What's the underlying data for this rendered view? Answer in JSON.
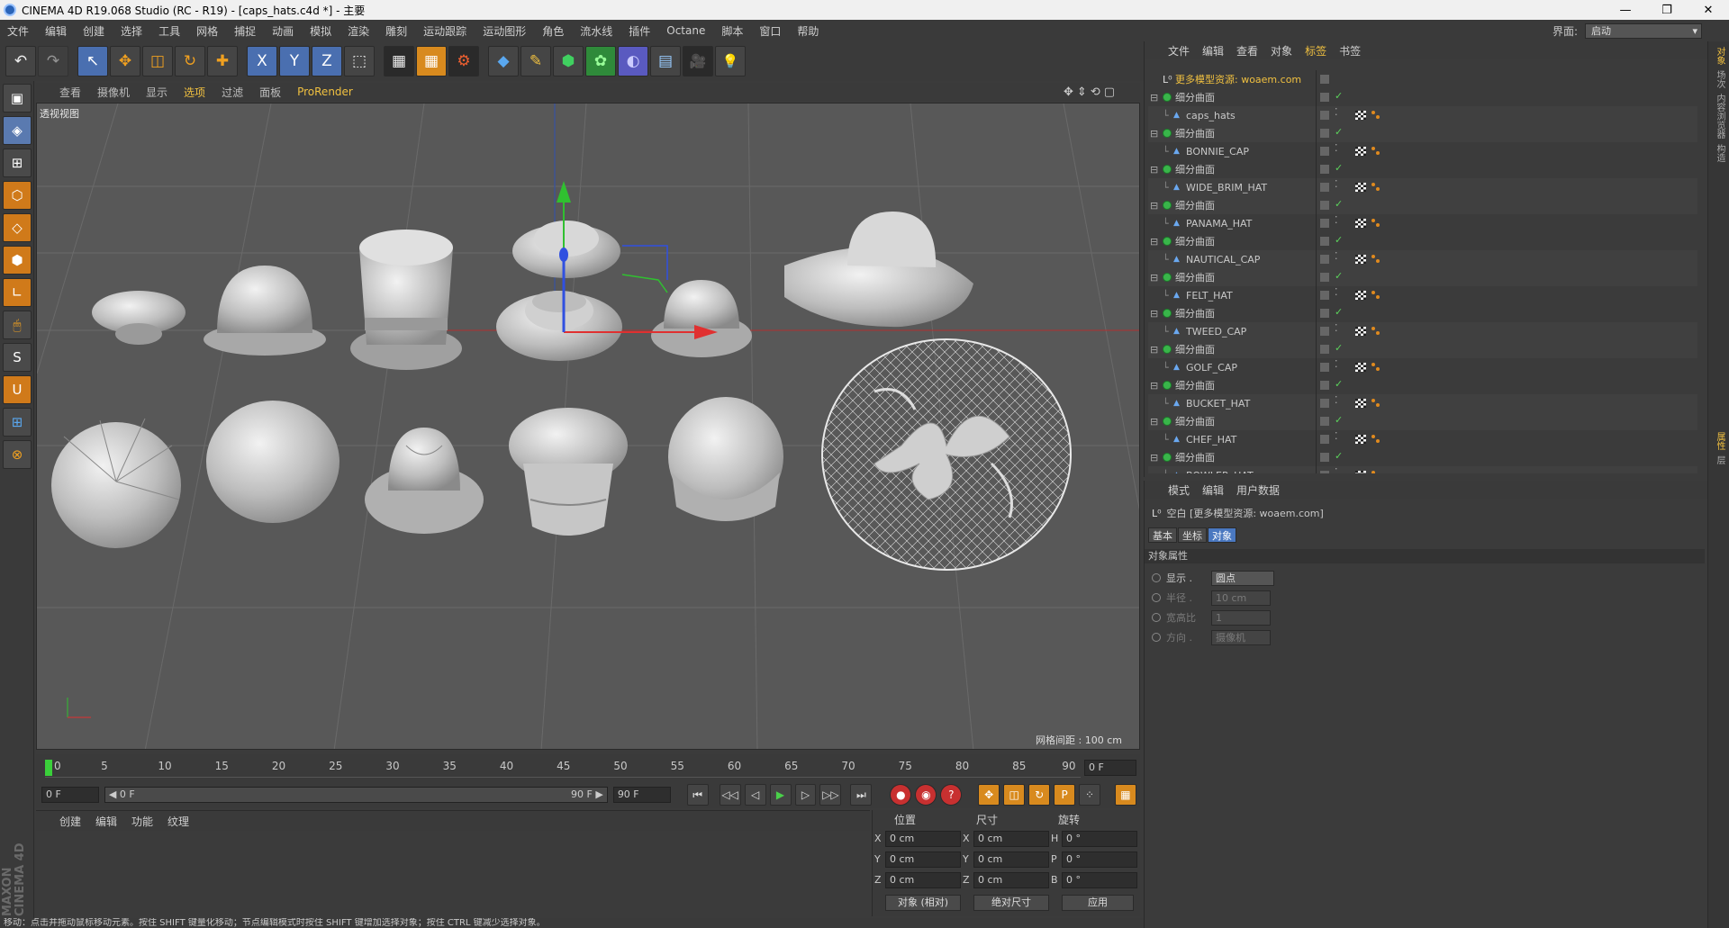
{
  "window": {
    "title": "CINEMA 4D R19.068 Studio (RC - R19) - [caps_hats.c4d *] - 主要",
    "controls": [
      "—",
      "❐",
      "✕"
    ]
  },
  "menu": [
    "文件",
    "编辑",
    "创建",
    "选择",
    "工具",
    "网格",
    "捕捉",
    "动画",
    "模拟",
    "渲染",
    "雕刻",
    "运动跟踪",
    "运动图形",
    "角色",
    "流水线",
    "插件",
    "Octane",
    "脚本",
    "窗口",
    "帮助"
  ],
  "layout": {
    "label": "界面:",
    "value": "启动"
  },
  "toolbar": {
    "undo": "↶",
    "redo": "↷",
    "select": "↖",
    "move": "✥",
    "scale": "◫",
    "rotate": "↻",
    "add": "✚",
    "x": "X",
    "y": "Y",
    "z": "Z",
    "coord": "⬚",
    "render_view": "▦",
    "render_pic": "▦",
    "render_settings": "⚙",
    "cube": "◆",
    "pen": "✎",
    "subdiv": "⬢",
    "array": "✿",
    "deform": "◐",
    "floor": "▤",
    "camera": "🎥",
    "light": "💡"
  },
  "left_tools": [
    "▣",
    "◈",
    "⊞",
    "⬡",
    "◇",
    "⬢",
    "∟",
    "🖱",
    "S",
    "U",
    "⊞",
    "⊗"
  ],
  "viewport": {
    "menu": [
      "查看",
      "摄像机",
      "显示",
      "选项",
      "过滤",
      "面板",
      "ProRender"
    ],
    "highlight_index": 3,
    "nav": "✥⇕⟲▢",
    "label": "透视视图",
    "grid": "网格间距 : 100 cm"
  },
  "timeline": {
    "ticks": [
      "0",
      "5",
      "10",
      "15",
      "20",
      "25",
      "30",
      "35",
      "40",
      "45",
      "50",
      "55",
      "60",
      "65",
      "70",
      "75",
      "80",
      "85",
      "90"
    ],
    "current": "0 F"
  },
  "transport": {
    "start": "0 F",
    "range_start": "◀ 0 F",
    "range_end": "90 F ▶",
    "end": "90 F",
    "buttons": [
      "⏮",
      "◁◁",
      "◁",
      "▶",
      "▷",
      "▷▷",
      "⏭"
    ]
  },
  "material": {
    "menu": [
      "创建",
      "编辑",
      "功能",
      "纹理"
    ],
    "brand": "MAXON CINEMA 4D"
  },
  "coords": {
    "headers": [
      "位置",
      "尺寸",
      "旋转"
    ],
    "rows": [
      {
        "a1": "X",
        "v1": "0 cm",
        "a2": "X",
        "v2": "0 cm",
        "a3": "H",
        "v3": "0 °"
      },
      {
        "a1": "Y",
        "v1": "0 cm",
        "a2": "Y",
        "v2": "0 cm",
        "a3": "P",
        "v3": "0 °"
      },
      {
        "a1": "Z",
        "v1": "0 cm",
        "a2": "Z",
        "v2": "0 cm",
        "a3": "B",
        "v3": "0 °"
      }
    ],
    "mode": "对象 (相对)",
    "size_mode": "绝对尺寸",
    "apply": "应用"
  },
  "status": "移动：点击并拖动鼠标移动元素。按住 SHIFT 键量化移动；节点编辑模式时按住 SHIFT 键增加选择对象；按住 CTRL 键减少选择对象。",
  "objects": {
    "menu": [
      "文件",
      "编辑",
      "查看",
      "对象",
      "标签",
      "书签"
    ],
    "active_menu": 4,
    "top": "更多模型资源: woaem.com",
    "group_label": "细分曲面",
    "items": [
      "caps_hats",
      "BONNIE_CAP",
      "WIDE_BRIM_HAT",
      "PANAMA_HAT",
      "NAUTICAL_CAP",
      "FELT_HAT",
      "TWEED_CAP",
      "GOLF_CAP",
      "BUCKET_HAT",
      "CHEF_HAT",
      "BOWLER_HAT"
    ]
  },
  "attributes": {
    "menu": [
      "模式",
      "编辑",
      "用户数据"
    ],
    "title": "空白 [更多模型资源: woaem.com]",
    "tabs": [
      "基本",
      "坐标",
      "对象"
    ],
    "section": "对象属性",
    "rows": [
      {
        "label": "显示 .",
        "value": "圆点",
        "enabled": true
      },
      {
        "label": "半径 .",
        "value": "10 cm",
        "enabled": false
      },
      {
        "label": "宽高比",
        "value": "1",
        "enabled": false
      },
      {
        "label": "方向 .",
        "value": "摄像机",
        "enabled": false
      }
    ]
  },
  "side_tabs": [
    "对象",
    "场次",
    "内容浏览器",
    "构造",
    "属性",
    "层"
  ]
}
